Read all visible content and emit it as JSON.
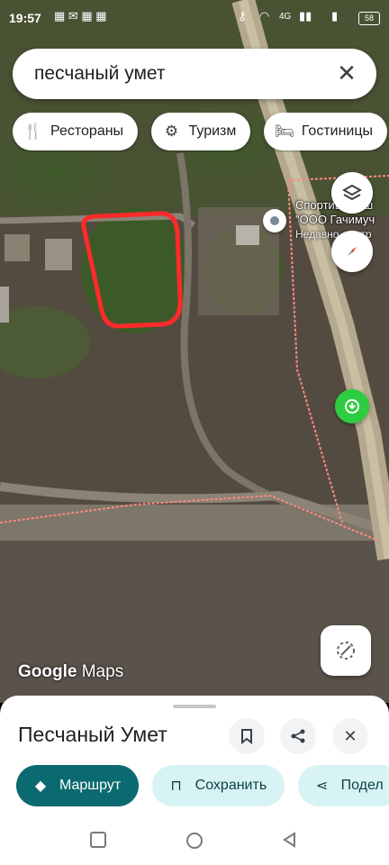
{
  "status": {
    "time": "19:57",
    "battery": "58",
    "network": "4G"
  },
  "search": {
    "query": "песчаный умет"
  },
  "chips": [
    {
      "label": "Рестораны",
      "icon": "restaurant-icon"
    },
    {
      "label": "Туризм",
      "icon": "tourism-icon"
    },
    {
      "label": "Гостиницы",
      "icon": "hotel-icon"
    }
  ],
  "map": {
    "poi_title_1": "Спортивная ш",
    "poi_title_2": "\"ООО Гачимуч",
    "poi_subtitle": "Недавно смотр",
    "logo_google": "Google",
    "logo_maps": "Maps"
  },
  "place": {
    "title": "Песчаный Умет",
    "actions": {
      "route": "Маршрут",
      "save": "Сохранить",
      "share": "Подел"
    }
  },
  "colors": {
    "accent": "#0b6a6f",
    "accent_light": "#d8f3f4",
    "boundary": "#ff5a5a",
    "selection": "#ff2a2a"
  }
}
